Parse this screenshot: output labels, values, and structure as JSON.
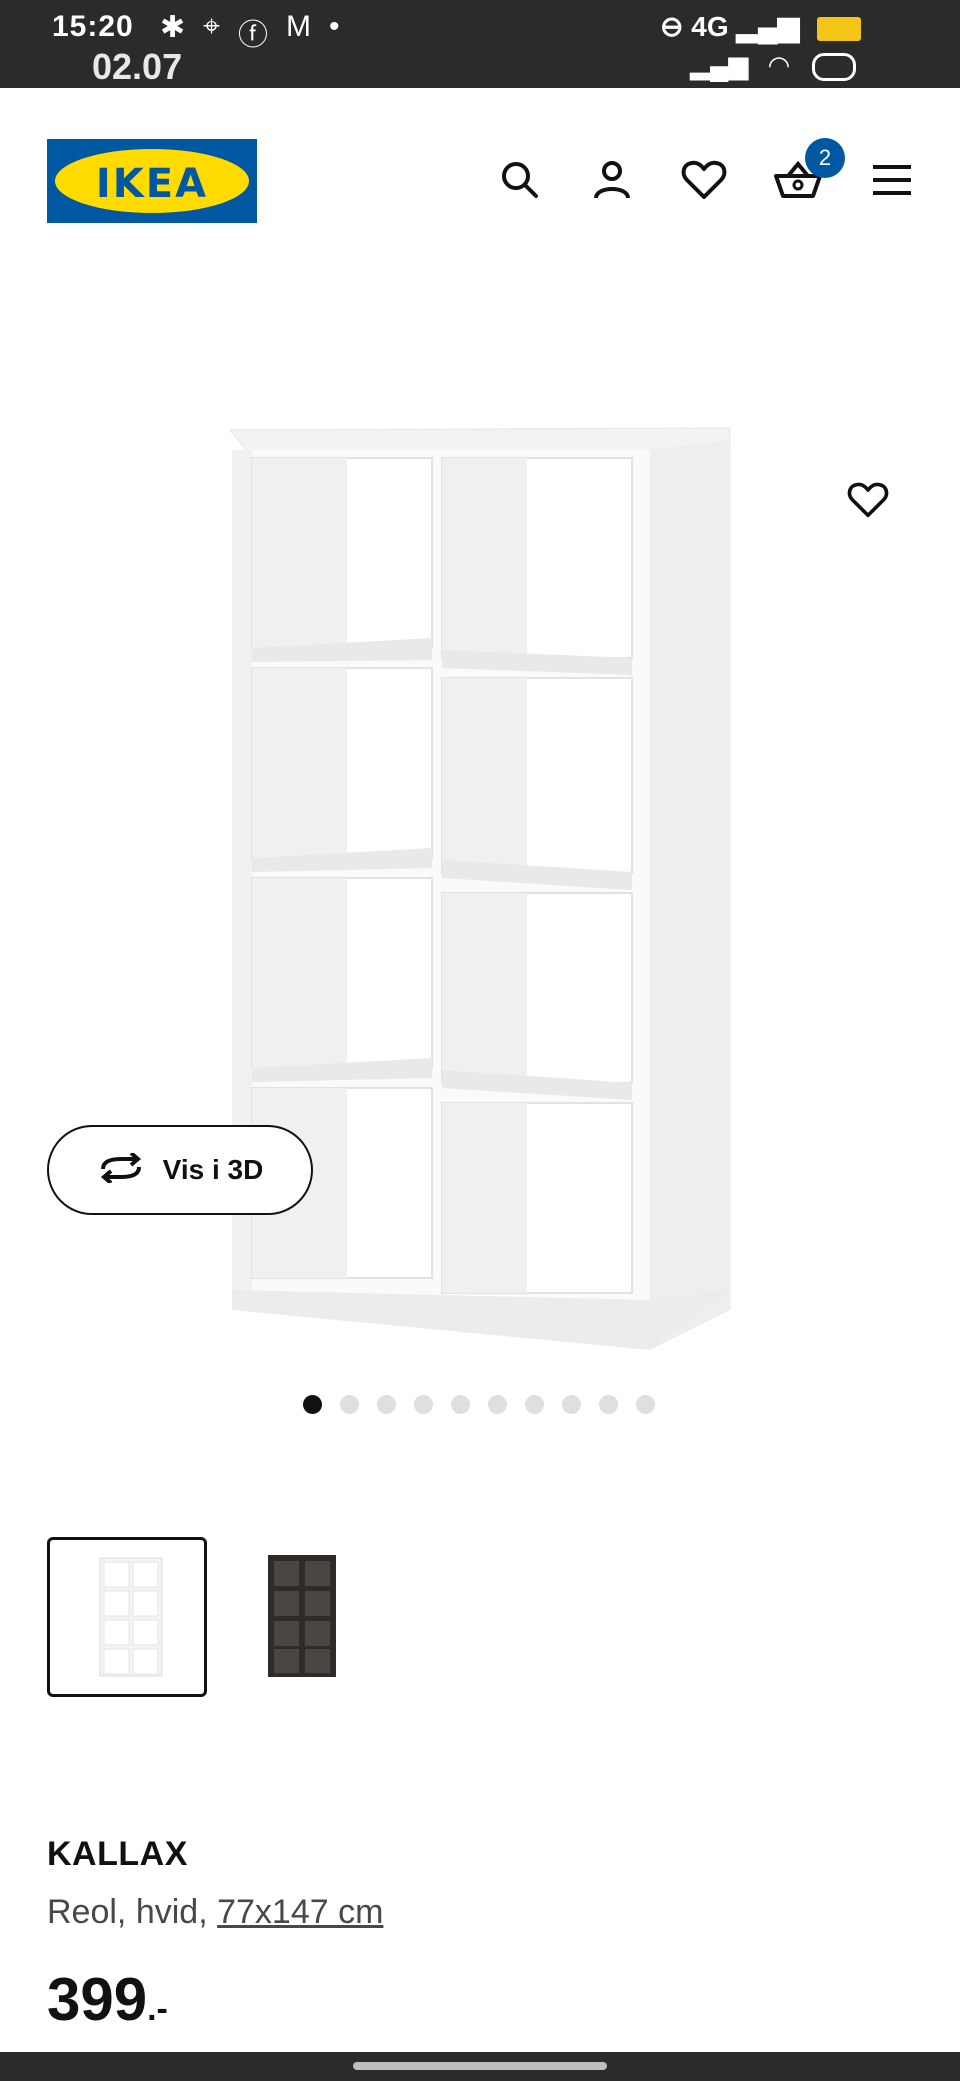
{
  "status_bar": {
    "time": "15:20",
    "date": "02.07",
    "network": "4G",
    "icons": [
      "bell-icon",
      "location-icon",
      "facebook-icon",
      "gmail-icon",
      "dot-icon",
      "bed-icon",
      "mute-icon",
      "signal-icon",
      "wifi-icon",
      "battery-icon"
    ]
  },
  "header": {
    "logo_text": "IKEA",
    "cart_count": "2",
    "icons": [
      "search-icon",
      "account-icon",
      "wishlist-icon",
      "cart-icon",
      "menu-icon"
    ]
  },
  "product": {
    "view_3d_label": "Vis i 3D",
    "image_count": 10,
    "active_image_index": 0,
    "name": "KALLAX",
    "description_prefix": "Reol, hvid, ",
    "dimensions": "77x147 cm",
    "price": "399",
    "price_suffix": ".-",
    "variants": [
      "white",
      "black-brown"
    ]
  },
  "colors": {
    "brand_blue": "#0058a3",
    "brand_yellow": "#ffdb00",
    "status_bar_bg": "#2b2b2b"
  }
}
